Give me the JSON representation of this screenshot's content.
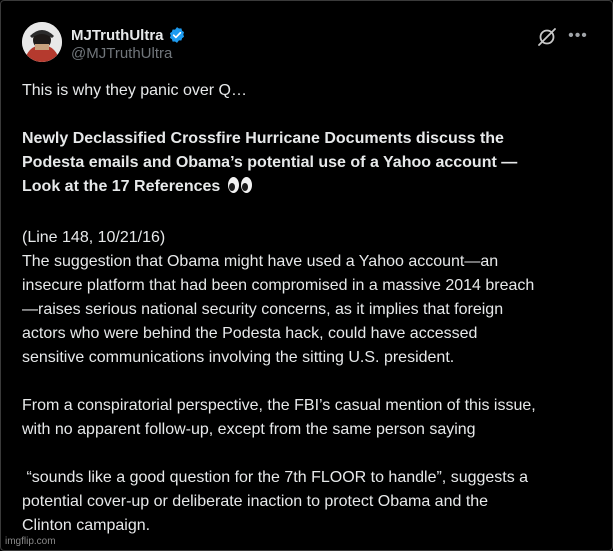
{
  "post": {
    "author": {
      "display_name": "MJTruthUltra",
      "handle": "@MJTruthUltra",
      "verified": true
    },
    "icons": {
      "verified": "verified-badge-icon",
      "grok": "grok-icon",
      "more": "more-options-icon"
    },
    "text": {
      "line1": "This is why they panic over Q…",
      "headline_1": "Newly Declassified Crossfire Hurricane Documents discuss the",
      "headline_2": "Podesta emails and Obama’s potential use of a Yahoo account —",
      "headline_3": "Look at the 17 References",
      "ref": "(Line 148, 10/21/16)",
      "p1_1": "The suggestion that Obama might have used a Yahoo account—an",
      "p1_2": "insecure platform that had been compromised in a massive 2014 breach",
      "p1_3": "—raises serious national security concerns, as it implies that foreign",
      "p1_4": "actors who were behind the Podesta hack, could have accessed",
      "p1_5": "sensitive communications involving the sitting U.S. president.",
      "p2_1": "From a conspiratorial perspective, the FBI’s casual mention of this issue,",
      "p2_2": "with no apparent follow-up, except from the same person saying",
      "p3_1": " “sounds like a good question for the 7th FLOOR to handle”, suggests a",
      "p3_2": "potential cover-up or deliberate inaction to protect Obama and the",
      "p3_3": "Clinton campaign."
    },
    "emoji": "eyes-emoji"
  },
  "watermark": "imgflip.com",
  "colors": {
    "background": "#000000",
    "text": "#e7e9ea",
    "secondary": "#71767b",
    "verified_blue": "#1d9bf0"
  }
}
